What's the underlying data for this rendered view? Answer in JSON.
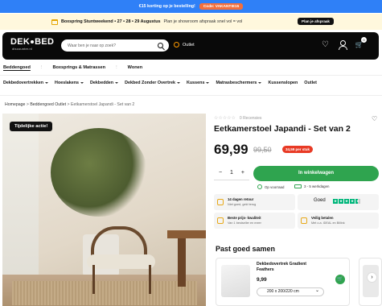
{
  "topbar": {
    "text": "€15 korting op je bestelling!",
    "promo_label": "Code: VAKANTIE15"
  },
  "announcement": {
    "bold": "Boxspring Stuntweekend • 27 • 28 • 29 Augustus",
    "text": "Plan je showroom afspraak snel vol = vol",
    "button": "Plan je afspraak"
  },
  "header": {
    "logo_main": "DEK",
    "logo_second": "BED",
    "logo_sub": "discounter.nl",
    "search_placeholder": "Waar ben je naar op zoek?",
    "outlet_label": "Outlet",
    "cart_count": "0"
  },
  "categories": [
    {
      "label": "Beddengoed",
      "selected": true
    },
    {
      "label": "Boxsprings & Matrassen",
      "selected": false
    },
    {
      "label": "Wonen",
      "selected": false
    }
  ],
  "subnav": [
    "Dekbedovertrekken",
    "Hoeslakens",
    "Dekbedden",
    "Dekbed Zonder Overtrek",
    "Kussens",
    "Matrasbeschermers",
    "Kussenslopen",
    "Outlet"
  ],
  "breadcrumb": {
    "home": "Homepage",
    "parent": "Beddengoed Outlet",
    "current": "Eetkamerstoel Japandi - Set van 2",
    "sep": ">"
  },
  "product": {
    "tag": "Tijdelijke actie!",
    "reviews": "0 Recensies",
    "title": "Eetkamerstoel Japandi - Set van 2",
    "price": "69,99",
    "old_price": "99,50",
    "saving": "34,59 per stuk",
    "qty": "1",
    "add_to_cart": "In winkelwagen",
    "usp_stock": "Op voorraad",
    "usp_delivery": "3 - 5 werkdagen"
  },
  "trust_boxes": [
    {
      "title": "14 dagen retour",
      "sub": "Niet goed, geld terug"
    },
    {
      "title": "Goed",
      "sub": ""
    },
    {
      "title": "Beste prijs- kwaliteit",
      "sub": "Van 1 bestseller en meer"
    },
    {
      "title": "Veilig betalen",
      "sub": "Met o.a. iDEAL en Billink"
    }
  ],
  "recommend": {
    "heading": "Past goed samen",
    "name": "Dekbedovertrek Gradient Feathers",
    "price": "9,99",
    "size": "200 x 200/220 cm",
    "arrow": "›"
  }
}
